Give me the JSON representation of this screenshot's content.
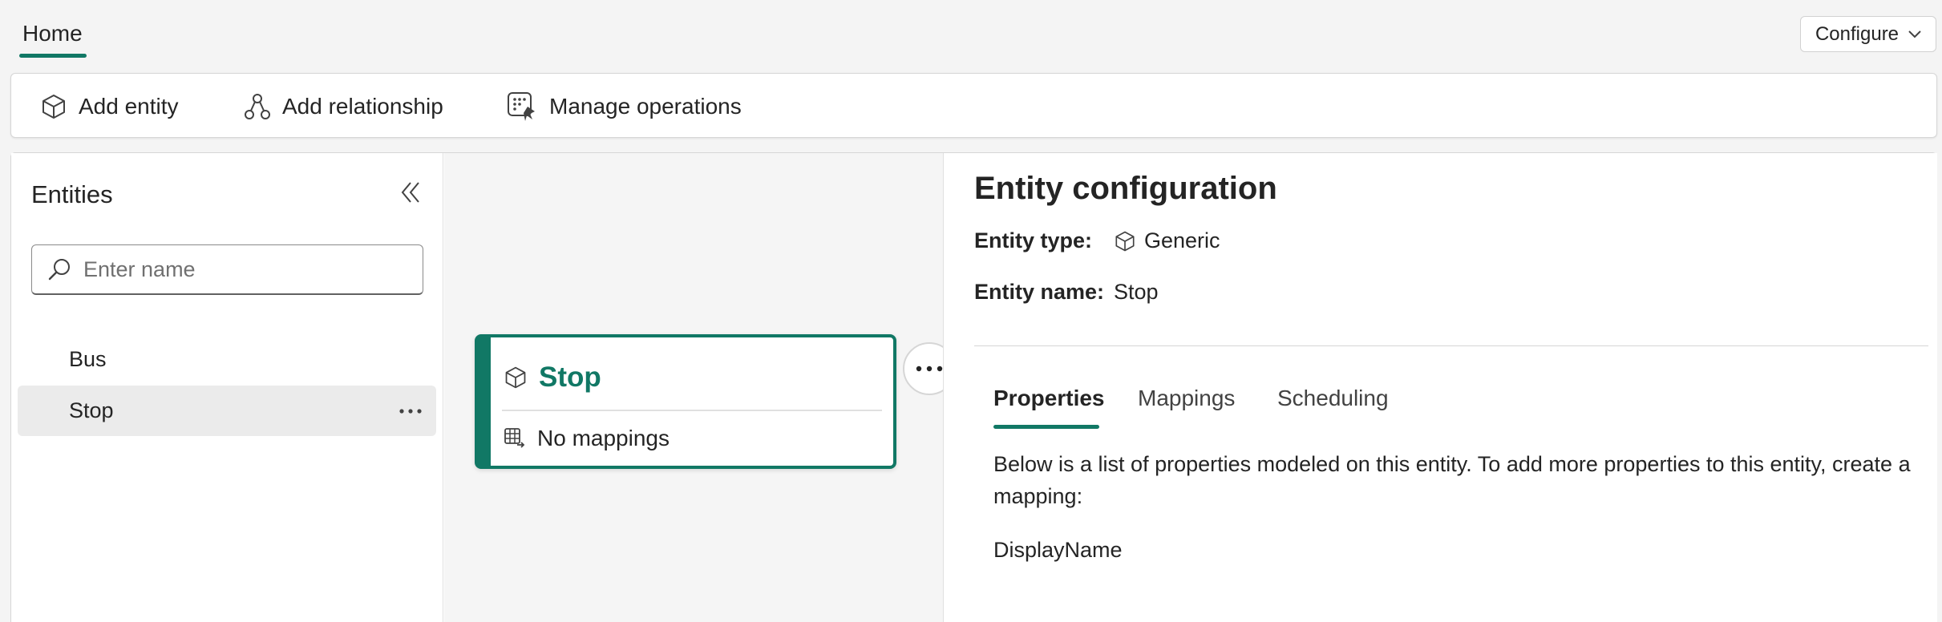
{
  "header": {
    "home_tab": "Home",
    "configure_label": "Configure"
  },
  "toolbar": {
    "add_entity": "Add entity",
    "add_relationship": "Add relationship",
    "manage_operations": "Manage operations"
  },
  "sidebar": {
    "title": "Entities",
    "search_placeholder": "Enter name",
    "search_value": "",
    "items": [
      {
        "label": "Bus",
        "selected": false
      },
      {
        "label": "Stop",
        "selected": true
      }
    ]
  },
  "canvas": {
    "card_title": "Stop",
    "card_mapping_text": "No mappings"
  },
  "config": {
    "title": "Entity configuration",
    "type_label": "Entity type:",
    "type_value": "Generic",
    "name_label": "Entity name:",
    "name_value": "Stop",
    "tabs": [
      {
        "label": "Properties",
        "active": true
      },
      {
        "label": "Mappings",
        "active": false
      },
      {
        "label": "Scheduling",
        "active": false
      }
    ],
    "description": "Below is a list of properties modeled on this entity. To add more properties to this entity, create a mapping:",
    "properties": [
      "DisplayName"
    ]
  },
  "colors": {
    "accent": "#117865",
    "background": "#f4f4f4",
    "panel": "#ffffff"
  }
}
